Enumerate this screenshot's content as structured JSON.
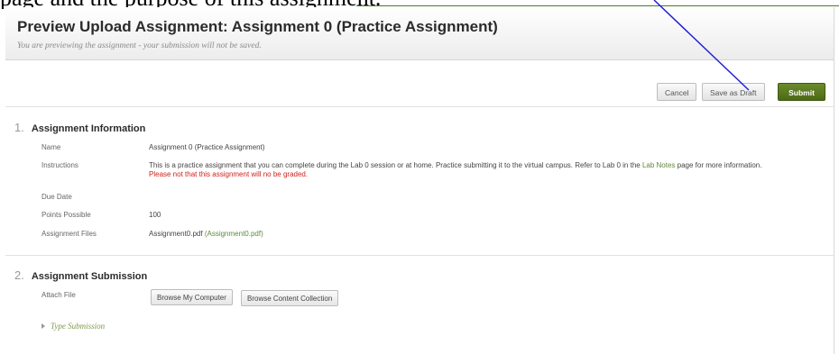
{
  "overlay": {
    "caption": "page and the purpose of this assignment."
  },
  "header": {
    "title": "Preview Upload Assignment: Assignment 0 (Practice Assignment)",
    "subtitle": "You are previewing the assignment - your submission will not be saved."
  },
  "actions": {
    "cancel": "Cancel",
    "save_draft": "Save as Draft",
    "submit": "Submit"
  },
  "section1": {
    "number": "1.",
    "title": "Assignment Information",
    "rows": [
      {
        "label": "Name",
        "value": "Assignment 0 (Practice Assignment)"
      },
      {
        "label": "Instructions",
        "text_a": "This is a practice assignment that you can complete during the Lab 0 session or at home. Practice submitting it to the virtual campus. Refer to Lab 0 in the ",
        "link": "Lab Notes",
        "text_b": " page for more information. ",
        "warning": "Please not that this assignment will no be graded."
      },
      {
        "label": "Due Date",
        "value": ""
      },
      {
        "label": "Points Possible",
        "value": "100"
      },
      {
        "label": "Assignment Files",
        "file": "Assignment0.pdf",
        "file_link": "(Assignment0.pdf)"
      }
    ]
  },
  "section2": {
    "number": "2.",
    "title": "Assignment Submission",
    "attach_label": "Attach File",
    "browse_computer": "Browse My Computer",
    "browse_collection": "Browse Content Collection",
    "type_submission": "Type Submission"
  },
  "colors": {
    "accent_green": "#5f8a3a",
    "submit_green": "#4c6a16",
    "warning_red": "#d0201c",
    "annotation_line": "#1f1fd8"
  }
}
